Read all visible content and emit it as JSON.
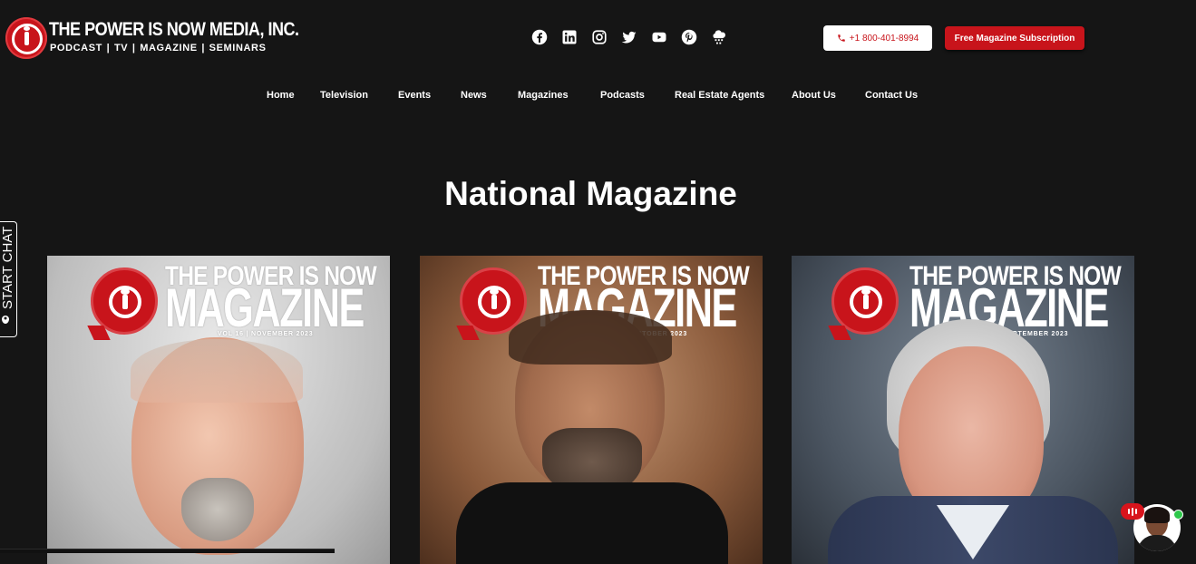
{
  "header": {
    "logo_title": "THE POWER IS NOW MEDIA, INC.",
    "logo_subtitle": "PODCAST | TV | MAGAZINE | SEMINARS",
    "social_icons": [
      "facebook-icon",
      "linkedin-icon",
      "instagram-icon",
      "twitter-icon",
      "youtube-icon",
      "pinterest-icon",
      "cloud-icon"
    ],
    "phone_label": "+1 800-401-8994",
    "subscribe_label": "Free Magazine Subscription"
  },
  "nav": {
    "items": [
      {
        "label": "Home"
      },
      {
        "label": "Television"
      },
      {
        "label": "Events"
      },
      {
        "label": "News"
      },
      {
        "label": "Magazines"
      },
      {
        "label": "Podcasts"
      },
      {
        "label": "Real Estate Agents"
      },
      {
        "label": "About Us"
      },
      {
        "label": "Contact Us"
      }
    ]
  },
  "main": {
    "title": "National Magazine",
    "covers": [
      {
        "title_line1": "THE POWER IS NOW",
        "title_line2": "MAGAZINE",
        "volume": "VOL 16 | NOVEMBER 2023"
      },
      {
        "title_line1": "THE POWER IS NOW",
        "title_line2": "MAGAZINE",
        "volume": "VOL 15 | OCTOBER 2023"
      },
      {
        "title_line1": "THE POWER IS NOW",
        "title_line2": "MAGAZINE",
        "volume": "VOL 14 | SEPTEMBER 2023"
      }
    ]
  },
  "chat_tab": {
    "label": "START CHAT"
  },
  "colors": {
    "background": "#151515",
    "brand_red": "#c8141b",
    "text": "#ffffff"
  }
}
